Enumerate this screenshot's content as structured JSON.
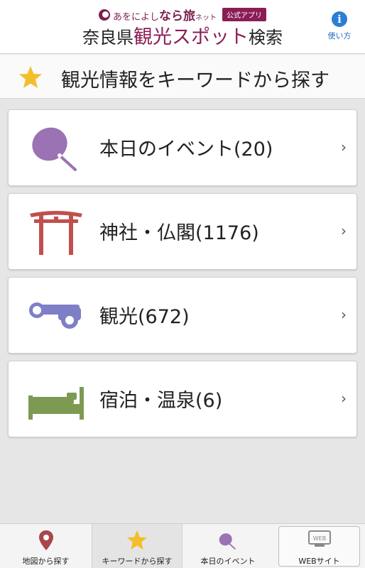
{
  "header": {
    "brand_prefix": "あをによし",
    "brand_main": "なら旅",
    "brand_suffix": "ネット",
    "official_badge": "公式アプリ",
    "title_pre": "奈良県",
    "title_accent": "観光スポット",
    "title_post": "検索",
    "help_icon_glyph": "i",
    "help_label": "使い方"
  },
  "section": {
    "title": "観光情報をキーワードから探す"
  },
  "cards": [
    {
      "label": "本日のイベント(20)",
      "icon": "uchiwa-fan-icon"
    },
    {
      "label": "神社・仏閣(1176)",
      "icon": "torii-gate-icon"
    },
    {
      "label": "観光(672)",
      "icon": "binoculars-icon"
    },
    {
      "label": "宿泊・温泉(6)",
      "icon": "bed-icon"
    }
  ],
  "chevron": "›",
  "tabs": [
    {
      "label": "地図から探す",
      "icon": "map-pin-icon"
    },
    {
      "label": "キーワードから探す",
      "icon": "star-icon",
      "active": true
    },
    {
      "label": "本日のイベント",
      "icon": "uchiwa-fan-icon"
    },
    {
      "label": "WEBサイト",
      "icon": "web-icon",
      "icon_text": "WEB"
    }
  ],
  "colors": {
    "brand": "#8b1d55",
    "star": "#f2bf2b",
    "fan": "#9b72b3",
    "torii": "#c0504d",
    "binoculars": "#7e7fc7",
    "bed": "#7d9a52",
    "map_pin": "#a8464a",
    "help": "#2a7fd4"
  }
}
